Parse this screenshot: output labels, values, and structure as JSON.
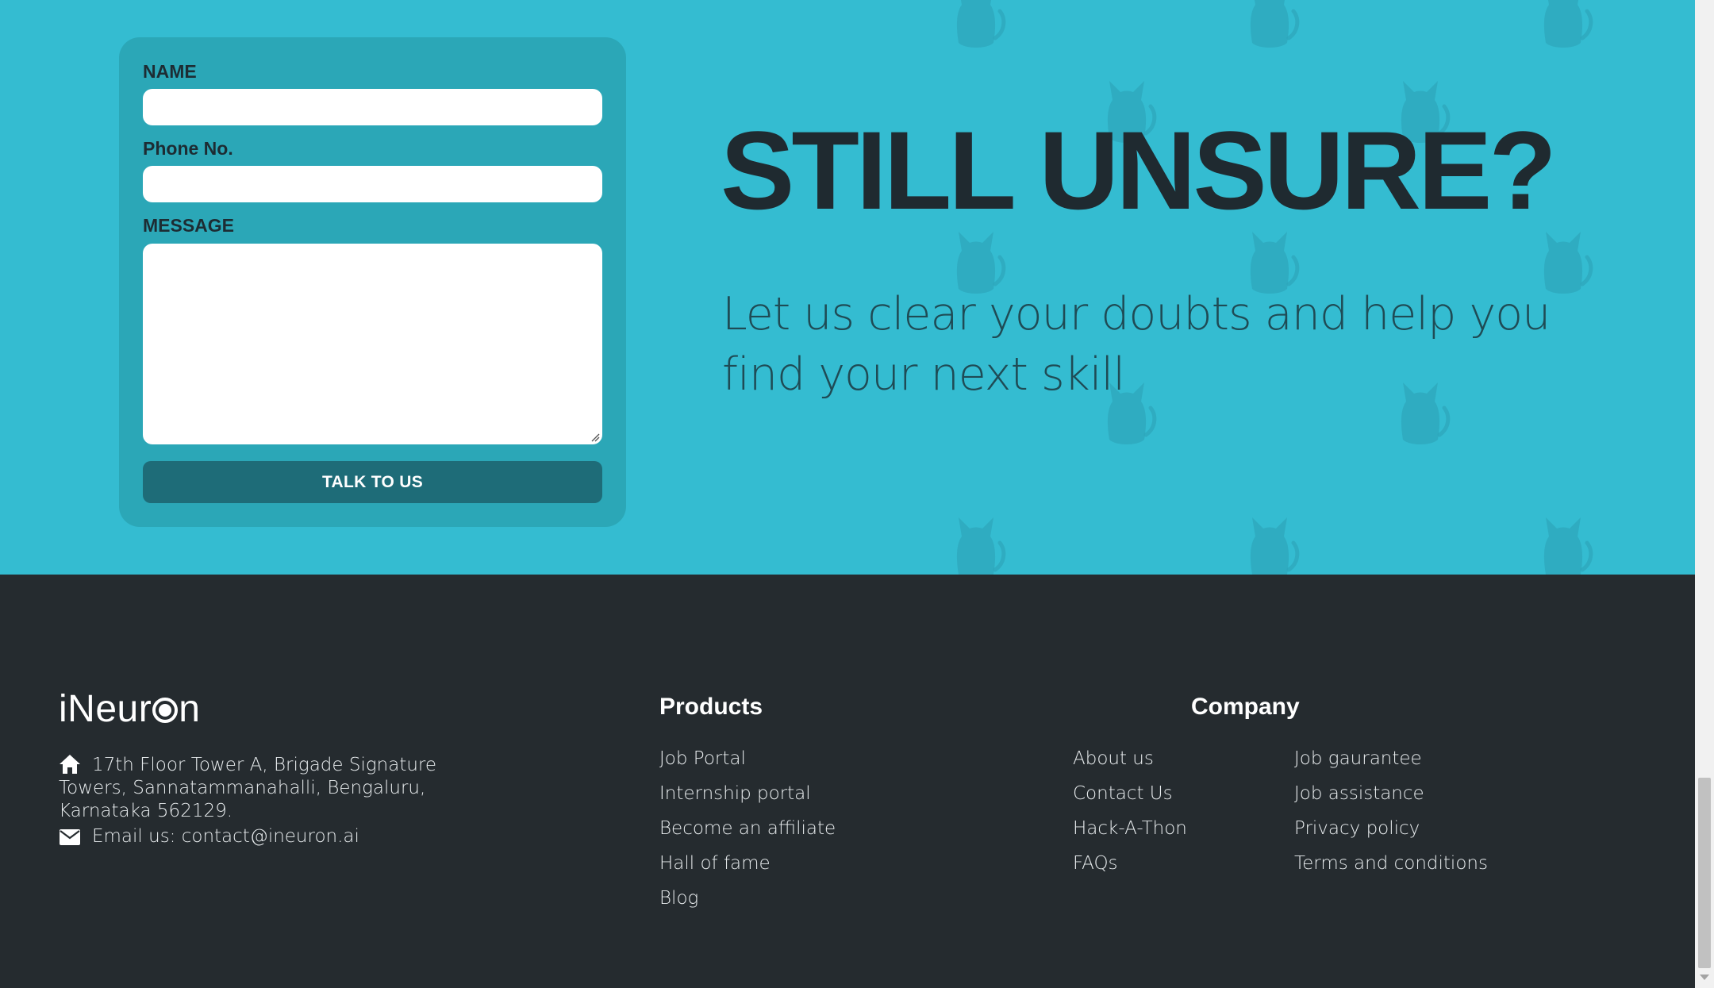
{
  "form": {
    "name_label": "NAME",
    "name_value": "",
    "phone_label": "Phone No.",
    "phone_value": "",
    "message_label": "MESSAGE",
    "message_value": "",
    "submit_label": "TALK TO US"
  },
  "hero": {
    "title": "STILL UNSURE?",
    "subtitle": "Let us clear your doubts and help you find your next skill"
  },
  "footer": {
    "logo": {
      "text_before": "iNeur",
      "text_after": "n"
    },
    "address": "17th Floor Tower A, Brigade Signature Towers, Sannatammanahalli, Bengaluru, Karnataka 562129.",
    "email": "Email us: contact@ineuron.ai",
    "products": {
      "heading": "Products",
      "links": [
        "Job Portal",
        "Internship portal",
        "Become an affiliate",
        "Hall of fame",
        "Blog"
      ]
    },
    "company": {
      "heading": "Company",
      "links_col1": [
        "About us",
        "Contact Us",
        "Hack-A-Thon",
        "FAQs"
      ],
      "links_col2": [
        "Job gaurantee",
        "Job assistance",
        "Privacy policy",
        "Terms and conditions"
      ]
    }
  },
  "icons": {
    "address": "home-icon",
    "email": "envelope-icon",
    "background_pattern": "cat-icon"
  },
  "colors": {
    "hero_bg": "#34bcd1",
    "form_card": "#2ba7b7",
    "button": "#1e6c78",
    "footer_bg": "#252b2f",
    "title": "#1f2a30"
  }
}
